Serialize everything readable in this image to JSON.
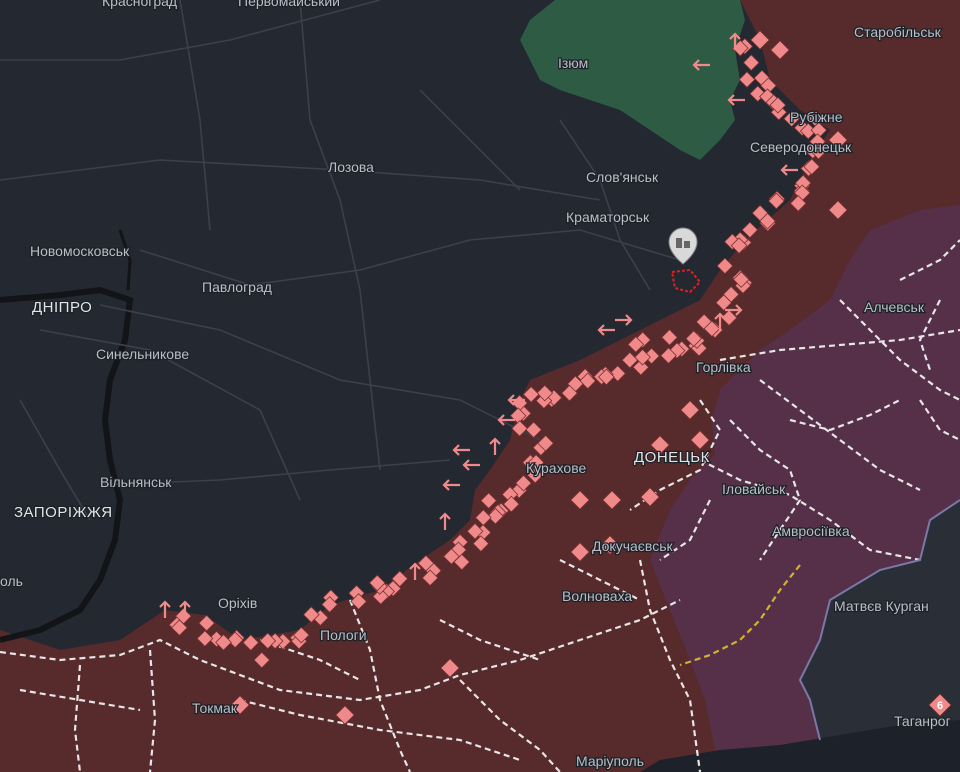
{
  "colors": {
    "background": "#232831",
    "occupied": "#5a2a2b",
    "occupied_old": "#56304c",
    "liberated": "#2f5f46",
    "contested_marker": "#f08a8a",
    "railway": "#e8e8e8",
    "border_dashed": "#d6b030"
  },
  "labels": {
    "krasnohrad": "Красноград",
    "pervomaiskyi": "Первомайський",
    "izium": "Ізюм",
    "starobilsk": "Старобільськ",
    "lozova": "Лозова",
    "sloviansk": "Слов'янськ",
    "sievierodonetsk": "Северодонецьк",
    "rubizhne": "Рубіжне",
    "kramatorsk": "Краматорськ",
    "novomoskovsk": "Новомосковськ",
    "dnipro": "ДНІПРО",
    "pavlohrad": "Павлоград",
    "alchevsk": "Алчевськ",
    "synelnykove": "Синельникове",
    "horlivka": "Горлівка",
    "kurakhove": "Курахове",
    "donetsk": "ДОНЕЦЬК",
    "vilniansk": "Вільнянськ",
    "ilovaisk": "Іловайськ",
    "zaporizhzhia": "ЗАПОРІЖЖЯ",
    "amvrosiivka": "Амвросіївка",
    "dokuchaievsk": "Докучаєвськ",
    "nikopol": "оль",
    "orikhiv": "Оріхів",
    "volnovakha": "Волноваха",
    "matviiv_kurhan": "Матвєв Курган",
    "polohy": "Пологи",
    "tokmak": "Токмак",
    "tahanrih": "Таганрог",
    "mariupol": "Маріуполь",
    "route_badge": "6"
  },
  "icons": {
    "settlement_marker": "city-pin-icon",
    "contested_marker": "diamond-icon",
    "advance_marker": "arrow-icon"
  }
}
